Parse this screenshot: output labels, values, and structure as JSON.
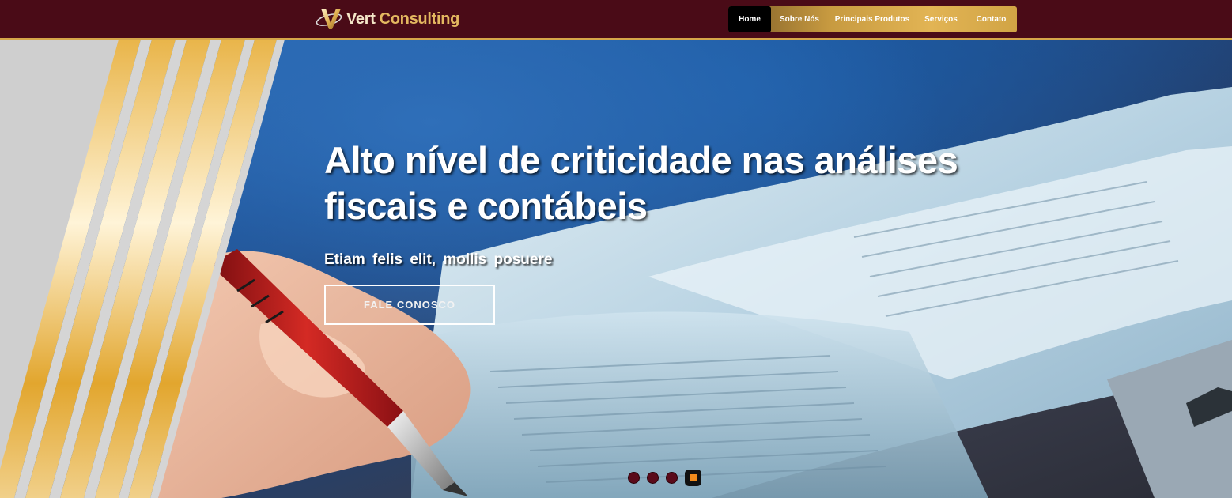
{
  "brand": {
    "name_part1": "Vert",
    "name_part2": "Consulting",
    "logo_icon": "v-monogram-icon"
  },
  "nav": {
    "items": [
      {
        "label": "Home",
        "active": true
      },
      {
        "label": "Sobre Nós",
        "active": false
      },
      {
        "label": "Principais Produtos",
        "active": false
      },
      {
        "label": "Serviços",
        "active": false
      },
      {
        "label": "Contato",
        "active": false
      }
    ]
  },
  "hero": {
    "title": "Alto nível de criticidade nas análises fiscais e contábeis",
    "subtitle": "Etiam felis elit, mollis posuere",
    "cta_label": "FALE CONOSCO"
  },
  "slider": {
    "slide_count": 4,
    "active_index": 4
  },
  "colors": {
    "header_bg": "#4a0b17",
    "gold": "#e2b454",
    "accent_orange": "#f08a1c"
  }
}
